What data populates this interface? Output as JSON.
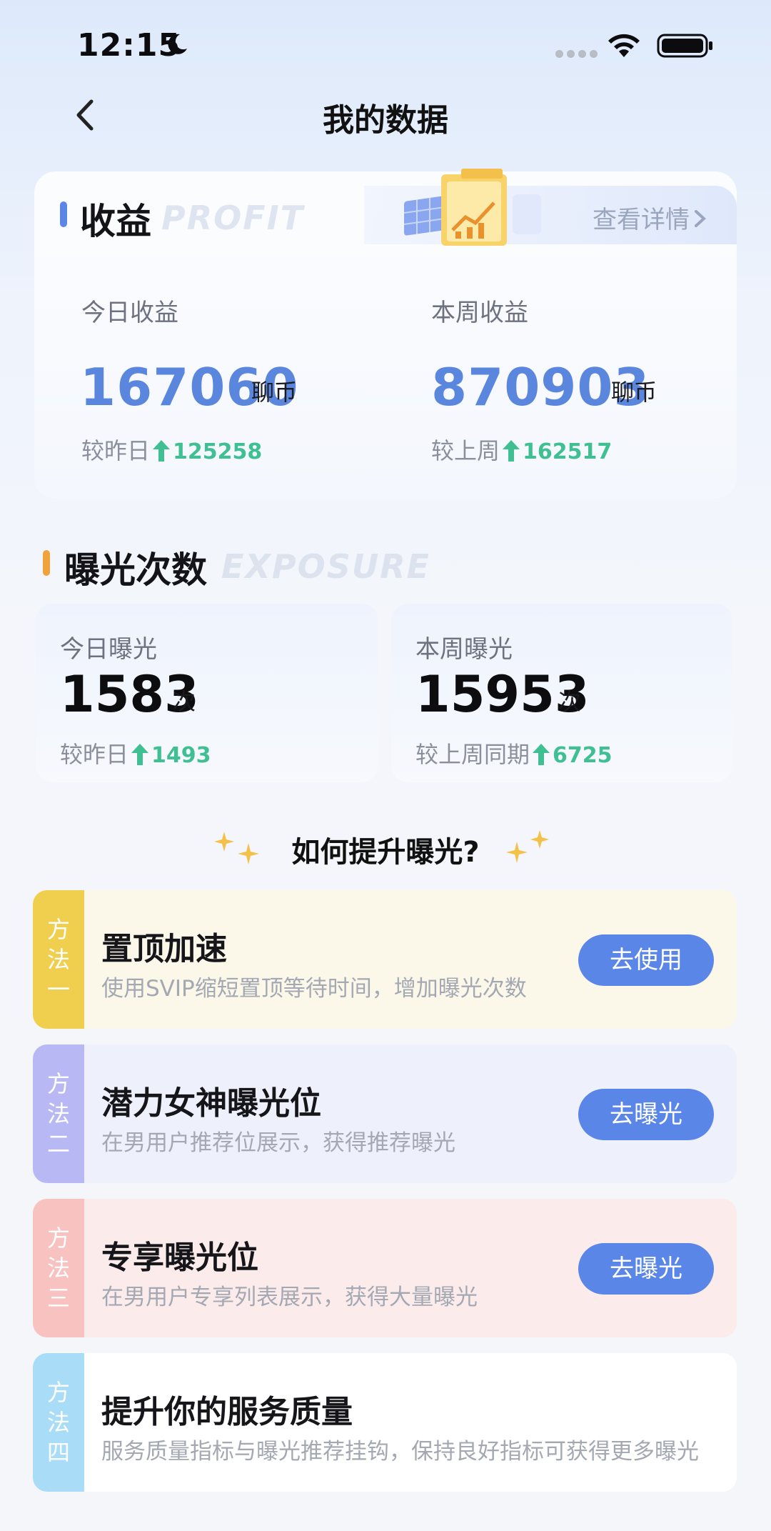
{
  "status_bar": {
    "time": "12:15"
  },
  "nav": {
    "title": "我的数据"
  },
  "profit": {
    "title": "收益",
    "ghost": "PROFIT",
    "details_link": "查看详情",
    "today": {
      "label": "今日收益",
      "value": "167060",
      "unit": "聊币",
      "compare_label": "较昨日",
      "compare_value": "125258"
    },
    "week": {
      "label": "本周收益",
      "value": "870903",
      "unit": "聊币",
      "compare_label": "较上周",
      "compare_value": "162517"
    }
  },
  "exposure": {
    "title": "曝光次数",
    "ghost": "EXPOSURE",
    "today": {
      "label": "今日曝光",
      "value": "1583",
      "unit": "次",
      "compare_label": "较昨日",
      "compare_value": "1493"
    },
    "week": {
      "label": "本周曝光",
      "value": "15953",
      "unit": "次",
      "compare_label": "较上周同期",
      "compare_value": "6725"
    }
  },
  "how": {
    "title": "如何提升曝光?"
  },
  "methods": [
    {
      "tag": [
        "方",
        "法",
        "一"
      ],
      "title": "置顶加速",
      "desc": "使用SVIP缩短置顶等待时间，增加曝光次数",
      "button": "去使用",
      "color": "#f0cf4f",
      "bg": "#fbf8ea"
    },
    {
      "tag": [
        "方",
        "法",
        "二"
      ],
      "title": "潜力女神曝光位",
      "desc": "在男用户推荐位展示，获得推荐曝光",
      "button": "去曝光",
      "color": "#b8b9f4",
      "bg": "#eef0fb"
    },
    {
      "tag": [
        "方",
        "法",
        "三"
      ],
      "title": "专享曝光位",
      "desc": "在男用户专享列表展示，获得大量曝光",
      "button": "去曝光",
      "color": "#f7c2c0",
      "bg": "#fbeceb"
    },
    {
      "tag": [
        "方",
        "法",
        "四"
      ],
      "title": "提升你的服务质量",
      "desc": "服务质量指标与曝光推荐挂钩，保持良好指标可获得更多曝光",
      "color": "#a9dcf6",
      "bg": "#ffffff"
    }
  ],
  "colors": {
    "accent_blue": "#5a86e8",
    "up_green": "#3fbf92"
  }
}
